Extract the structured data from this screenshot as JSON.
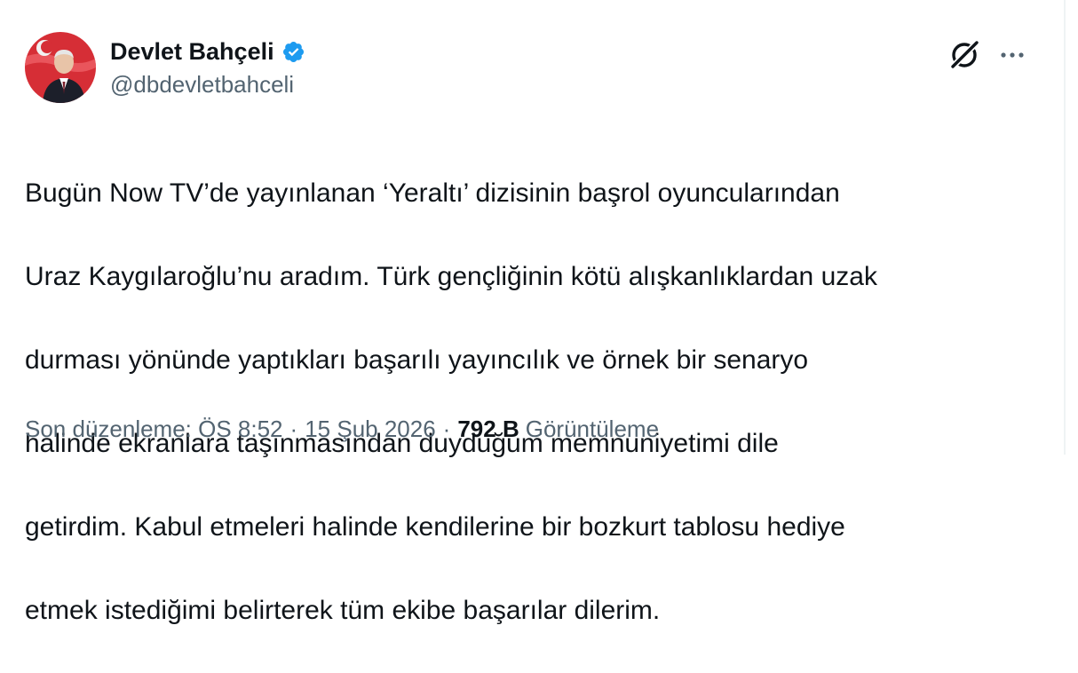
{
  "author": {
    "display_name": "Devlet Bahçeli",
    "handle": "@dbdevletbahceli",
    "verified": true,
    "verified_color": "#1d9bf0",
    "avatar_bg_color": "#d62e36"
  },
  "header_icons": {
    "grok": "grok-icon",
    "more": "more-icon"
  },
  "tweet": {
    "text_lines": [
      "Bugün Now TV’de yayınlanan ‘Yeraltı’ dizisinin başrol oyuncularından",
      "Uraz Kaygılaroğlu’nu aradım. Türk gençliğinin kötü alışkanlıklardan uzak",
      "durması yönünde yaptıkları başarılı yayıncılık ve örnek bir senaryo",
      "halinde ekranlara taşınmasından duyduğum memnuniyetimi dile",
      "getirdim. Kabul etmeleri halinde kendilerine bir bozkurt tablosu hediye",
      "etmek istediğimi belirterek tüm ekibe başarılar dilerim."
    ]
  },
  "meta": {
    "edited_label": "Son düzenleme: ÖS 8:52",
    "separator": "·",
    "date": "15 Şub 2026",
    "views_count": "792 B",
    "views_label": "Görüntüleme"
  },
  "colors": {
    "text_primary": "#0f1419",
    "text_secondary": "#536471",
    "border": "#eff3f4"
  }
}
